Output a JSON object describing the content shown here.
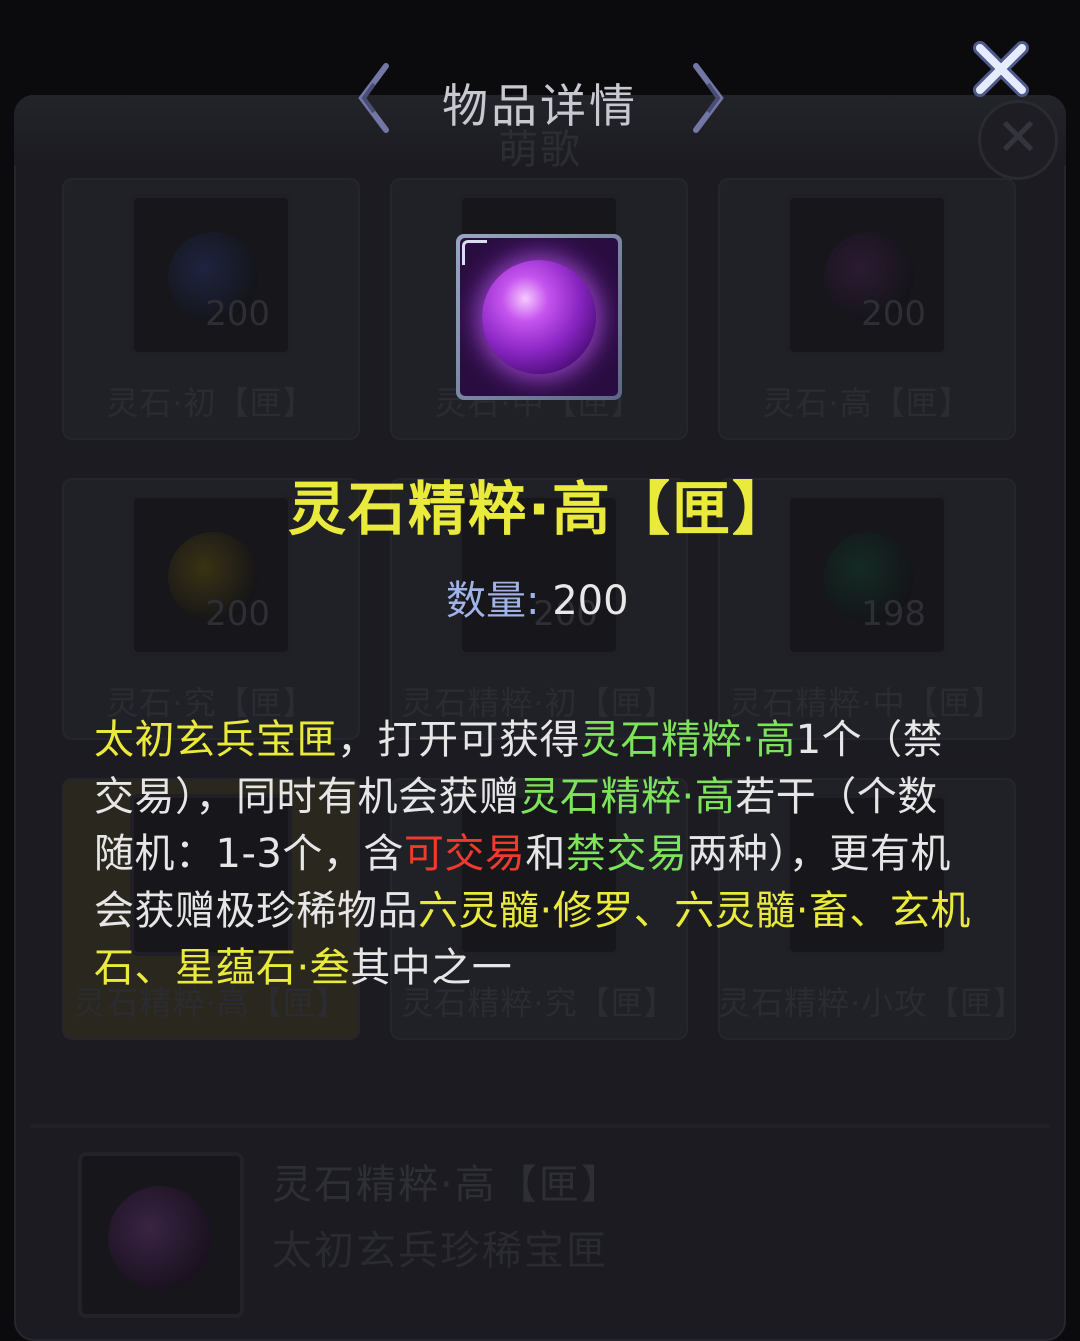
{
  "dialog": {
    "title": "物品详情",
    "item_name": "灵石精粹·高【匣】",
    "quantity_label": "数量:",
    "quantity_value": "200",
    "description": [
      {
        "text": "太初玄兵宝匣",
        "color": "yellow"
      },
      {
        "text": "，打开可获得",
        "color": "white"
      },
      {
        "text": "灵石精粹·高",
        "color": "green"
      },
      {
        "text": "1个（禁交易），同时有机会获赠",
        "color": "white"
      },
      {
        "text": "灵石精粹·高",
        "color": "green"
      },
      {
        "text": "若干（个数随机：1-3个，含",
        "color": "white"
      },
      {
        "text": "可交易",
        "color": "red"
      },
      {
        "text": "和",
        "color": "white"
      },
      {
        "text": "禁交易",
        "color": "green"
      },
      {
        "text": "两种），更有机会获赠极珍稀物品",
        "color": "white"
      },
      {
        "text": "六灵髓·修罗、六灵髓·畜、玄机石、星蕴石·叁",
        "color": "yellow"
      },
      {
        "text": "其中之一",
        "color": "white"
      }
    ],
    "icons": {
      "close": "close-x-icon",
      "item": "purple-spirit-stone-orb-icon",
      "prev": "chevron-left-icon",
      "next": "chevron-right-icon"
    }
  },
  "background": {
    "title": "萌歌",
    "grid": [
      {
        "name": "灵石·初【匣】",
        "qty": "200",
        "orb": "#1e2440"
      },
      {
        "name": "灵石·中【匣】",
        "qty": "",
        "orb": ""
      },
      {
        "name": "灵石·高【匣】",
        "qty": "200",
        "orb": "#2b1a33"
      },
      {
        "name": "灵石·究【匣】",
        "qty": "200",
        "orb": "#3a3214"
      },
      {
        "name": "灵石精粹·初【匣】",
        "qty": "200",
        "orb": ""
      },
      {
        "name": "灵石精粹·中【匣】",
        "qty": "198",
        "orb": "#142a24"
      },
      {
        "name": "灵石精粹·高【匣】",
        "qty": "",
        "orb": "",
        "selected": true
      },
      {
        "name": "灵石精粹·究【匣】",
        "qty": "",
        "orb": ""
      },
      {
        "name": "灵石精粹·小攻【匣】",
        "qty": "",
        "orb": ""
      }
    ],
    "detail": {
      "name": "灵石精粹·高【匣】",
      "desc": "太初玄兵珍稀宝匣"
    }
  },
  "colors": {
    "yellow": "#eaea3c",
    "green": "#7de35a",
    "red": "#f03a2e",
    "white": "#e6e6e6",
    "quantity_label": "#9fb3e6"
  }
}
